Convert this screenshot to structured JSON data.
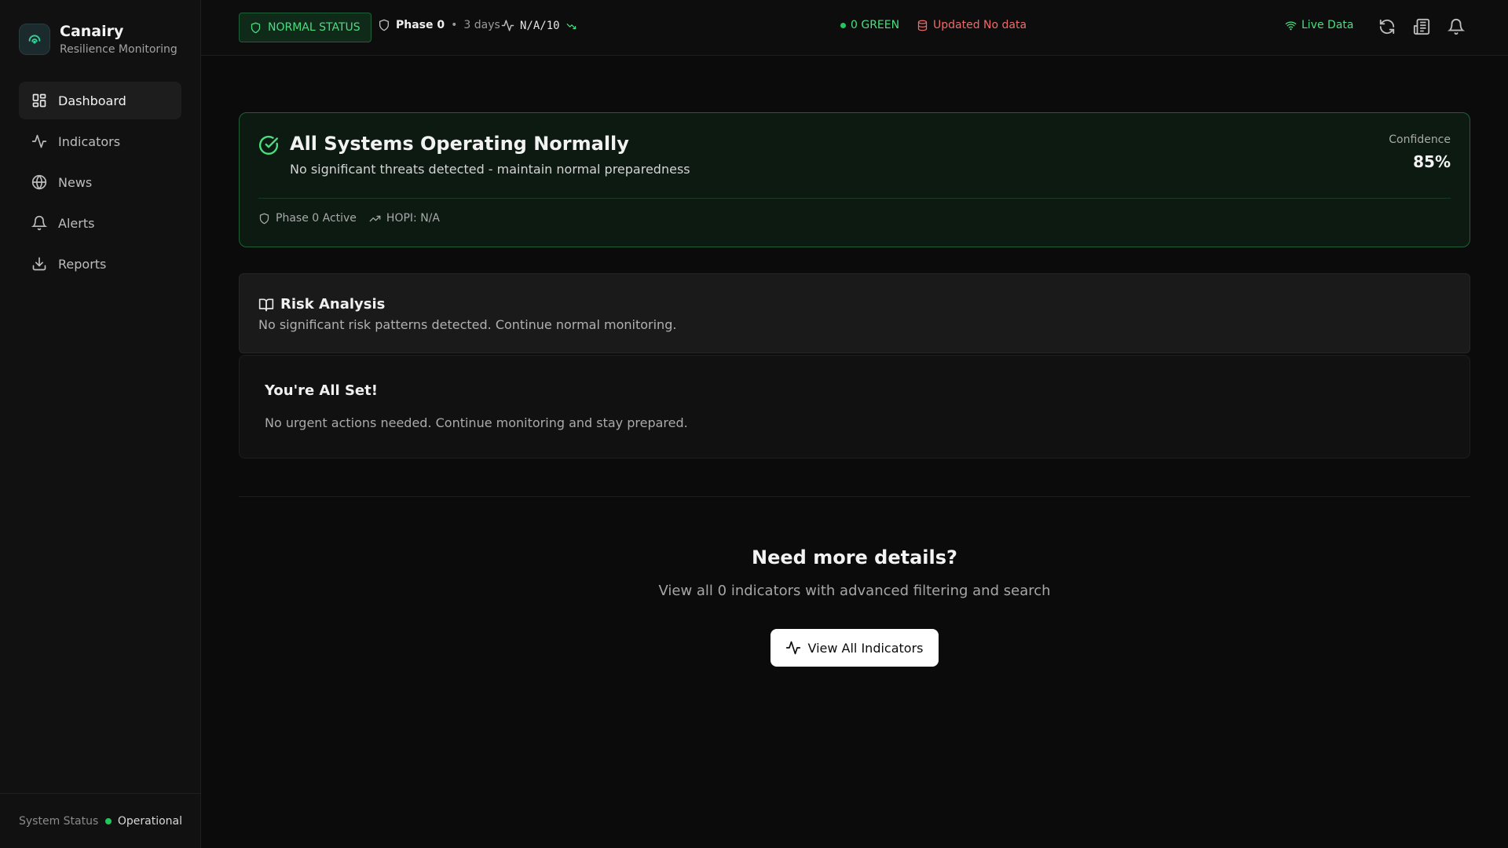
{
  "brand": {
    "name": "Canairy",
    "subtitle": "Resilience Monitoring"
  },
  "nav": [
    {
      "label": "Dashboard",
      "icon": "dashboard-icon",
      "active": true
    },
    {
      "label": "Indicators",
      "icon": "activity-icon"
    },
    {
      "label": "News",
      "icon": "globe-icon"
    },
    {
      "label": "Alerts",
      "icon": "bell-icon"
    },
    {
      "label": "Reports",
      "icon": "download-icon"
    }
  ],
  "footer": {
    "label": "System Status",
    "status": "Operational"
  },
  "topbar": {
    "status": "NORMAL STATUS",
    "phase": "Phase 0",
    "days": "3 days",
    "score": "N/A/10",
    "green": "0 GREEN",
    "updated": "Updated No data",
    "live": "Live Data"
  },
  "hero": {
    "title": "All Systems Operating Normally",
    "subtitle": "No significant threats detected - maintain normal preparedness",
    "confidence_label": "Confidence",
    "confidence_value": "85%",
    "phase_active": "Phase 0 Active",
    "hopi": "HOPI: N/A"
  },
  "risk": {
    "title": "Risk Analysis",
    "text": "No significant risk patterns detected. Continue normal monitoring."
  },
  "allset": {
    "title": "You're All Set!",
    "text": "No urgent actions needed. Continue monitoring and stay prepared."
  },
  "more": {
    "title": "Need more details?",
    "subtitle": "View all 0 indicators with advanced filtering and search",
    "button": "View All Indicators"
  },
  "colors": {
    "accent_green": "#4ade80",
    "status_green": "#22c55e",
    "alert_red": "#ef6b6b",
    "background": "#0b0b0b"
  }
}
